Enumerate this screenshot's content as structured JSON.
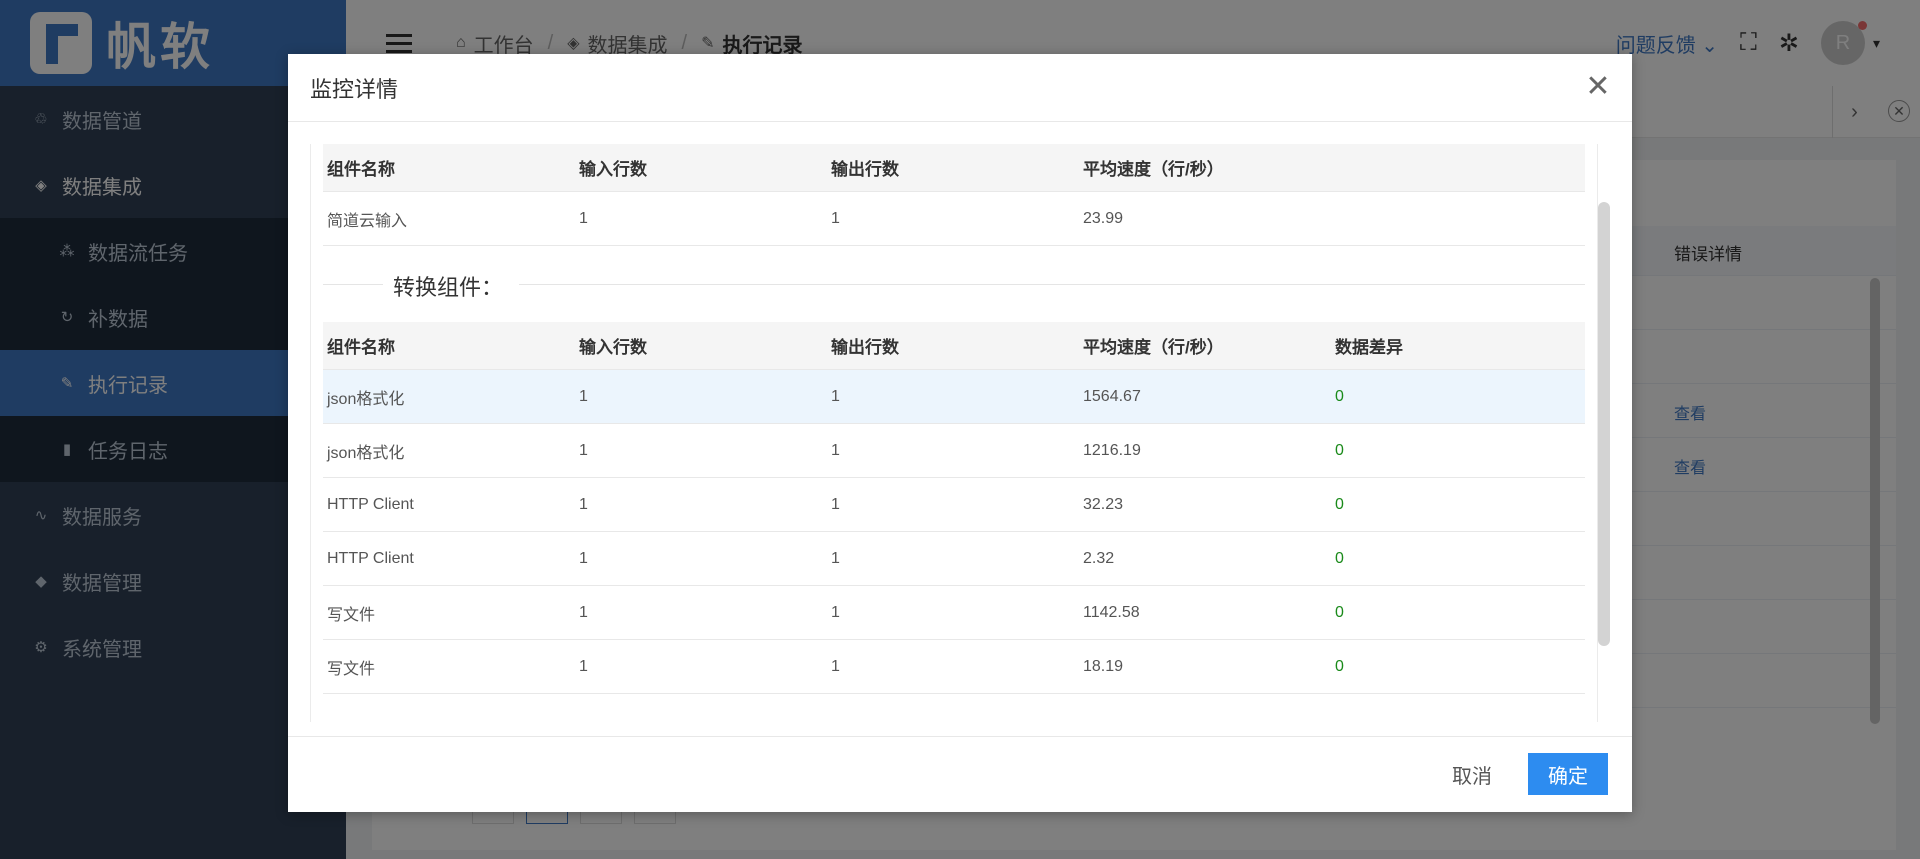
{
  "app": {
    "logo_text": "帆软"
  },
  "sidebar": {
    "items": [
      {
        "label": "数据管道",
        "icon": "pipeline-icon"
      },
      {
        "label": "数据集成",
        "icon": "layers-icon"
      },
      {
        "label": "数据流任务",
        "icon": "flow-icon"
      },
      {
        "label": "补数据",
        "icon": "refresh-icon"
      },
      {
        "label": "执行记录",
        "icon": "pencil-icon"
      },
      {
        "label": "任务日志",
        "icon": "file-icon"
      },
      {
        "label": "数据服务",
        "icon": "pulse-icon"
      },
      {
        "label": "数据管理",
        "icon": "cube-icon"
      },
      {
        "label": "系统管理",
        "icon": "gear-icon"
      }
    ]
  },
  "header": {
    "breadcrumb": [
      "工作台",
      "数据集成",
      "执行记录"
    ],
    "feedback": "问题反馈",
    "avatar_letter": "R"
  },
  "background": {
    "column_header": "错误详情",
    "view_link": "查看"
  },
  "dialog": {
    "title": "监控详情",
    "input_table": {
      "headers": [
        "组件名称",
        "输入行数",
        "输出行数",
        "平均速度（行/秒）"
      ],
      "rows": [
        [
          "简道云输入",
          "1",
          "1",
          "23.99"
        ]
      ]
    },
    "transform_section_title": "转换组件：",
    "transform_table": {
      "headers": [
        "组件名称",
        "输入行数",
        "输出行数",
        "平均速度（行/秒）",
        "数据差异"
      ],
      "rows": [
        [
          "json格式化",
          "1",
          "1",
          "1564.67",
          "0"
        ],
        [
          "json格式化",
          "1",
          "1",
          "1216.19",
          "0"
        ],
        [
          "HTTP Client",
          "1",
          "1",
          "32.23",
          "0"
        ],
        [
          "HTTP Client",
          "1",
          "1",
          "2.32",
          "0"
        ],
        [
          "写文件",
          "1",
          "1",
          "1142.58",
          "0"
        ],
        [
          "写文件",
          "1",
          "1",
          "18.19",
          "0"
        ]
      ]
    },
    "cancel_label": "取消",
    "ok_label": "确定"
  },
  "colors": {
    "brand": "#3f78c5",
    "sidebar_bg": "#304156",
    "primary_button": "#2d8cf0",
    "diff_ok": "#1a8a1a"
  }
}
